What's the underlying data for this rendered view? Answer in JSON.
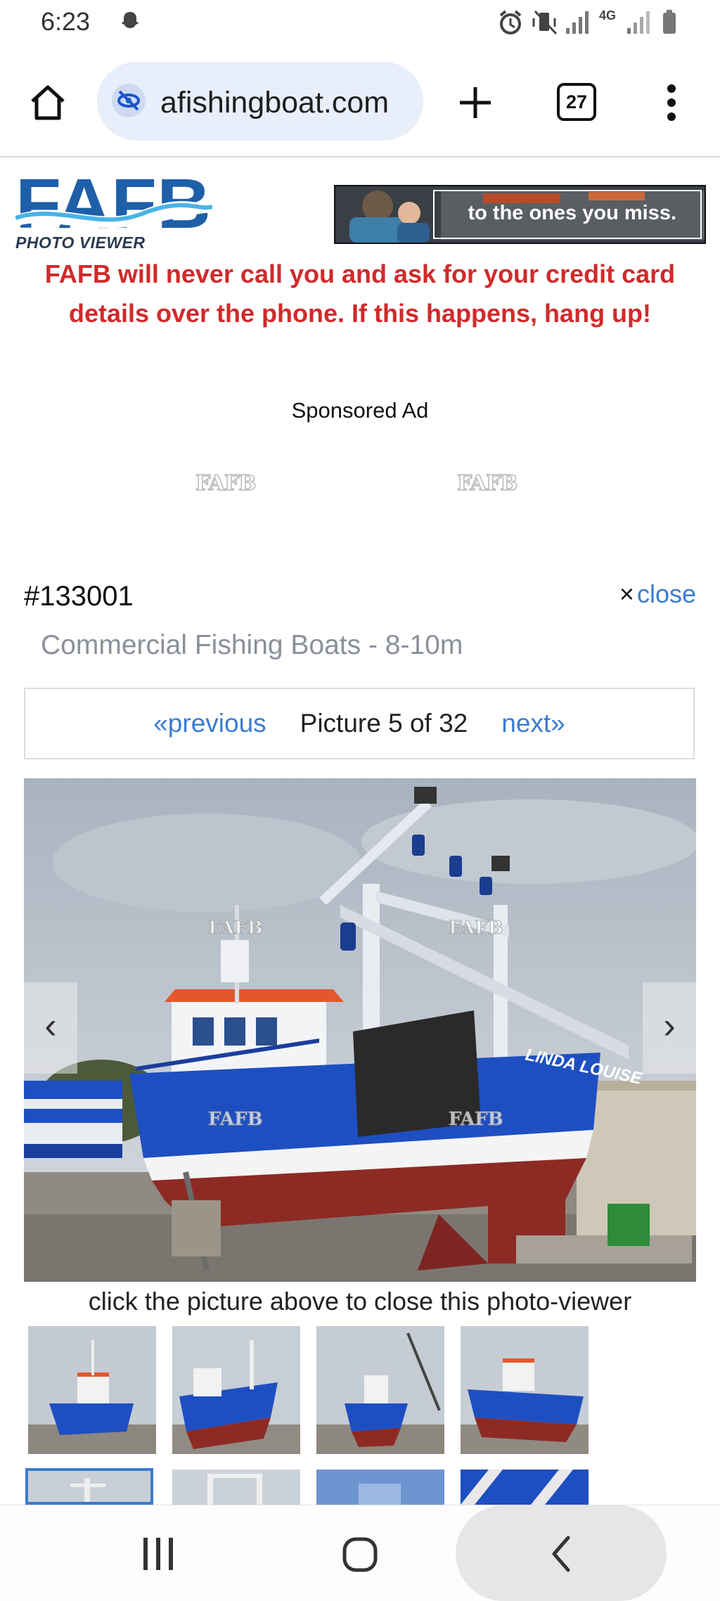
{
  "status_bar": {
    "time": "6:23",
    "network_label": "4G"
  },
  "browser": {
    "url": "afishingboat.com",
    "tab_count": "27"
  },
  "header": {
    "logo_text": "FAFB",
    "logo_subtitle": "PHOTO VIEWER",
    "ad_banner_text": "to the ones you miss.",
    "warning_text": "FAFB will never call you and ask for your credit card details over the phone. If this happens, hang up!",
    "sponsored_label": "Sponsored Ad",
    "ad_watermarks": [
      "FAFB",
      "FAFB"
    ]
  },
  "listing": {
    "id": "#133001",
    "close_label": "close",
    "close_symbol": "×",
    "category": "Commercial Fishing Boats - 8-10m"
  },
  "pager": {
    "previous_label": "«previous",
    "count_label": "Picture 5 of 32",
    "next_label": "next»"
  },
  "photo": {
    "boat_name": "LINDA LOUISE",
    "watermark": "FAFB",
    "prev_arrow": "‹",
    "next_arrow": "›",
    "caption": "click the picture above to close this photo-viewer"
  },
  "thumbnails": {
    "selected_index": 4,
    "count_visible": 8
  },
  "colors": {
    "accent_link": "#3b7bd1",
    "warning_red": "#d12a2a",
    "logo_blue": "#1f5fa8",
    "boat_blue": "#1e4fc2",
    "hull_red": "#8e2a24"
  },
  "system_nav": {
    "recents": "recents-icon",
    "home": "home-icon",
    "back": "back-icon"
  }
}
